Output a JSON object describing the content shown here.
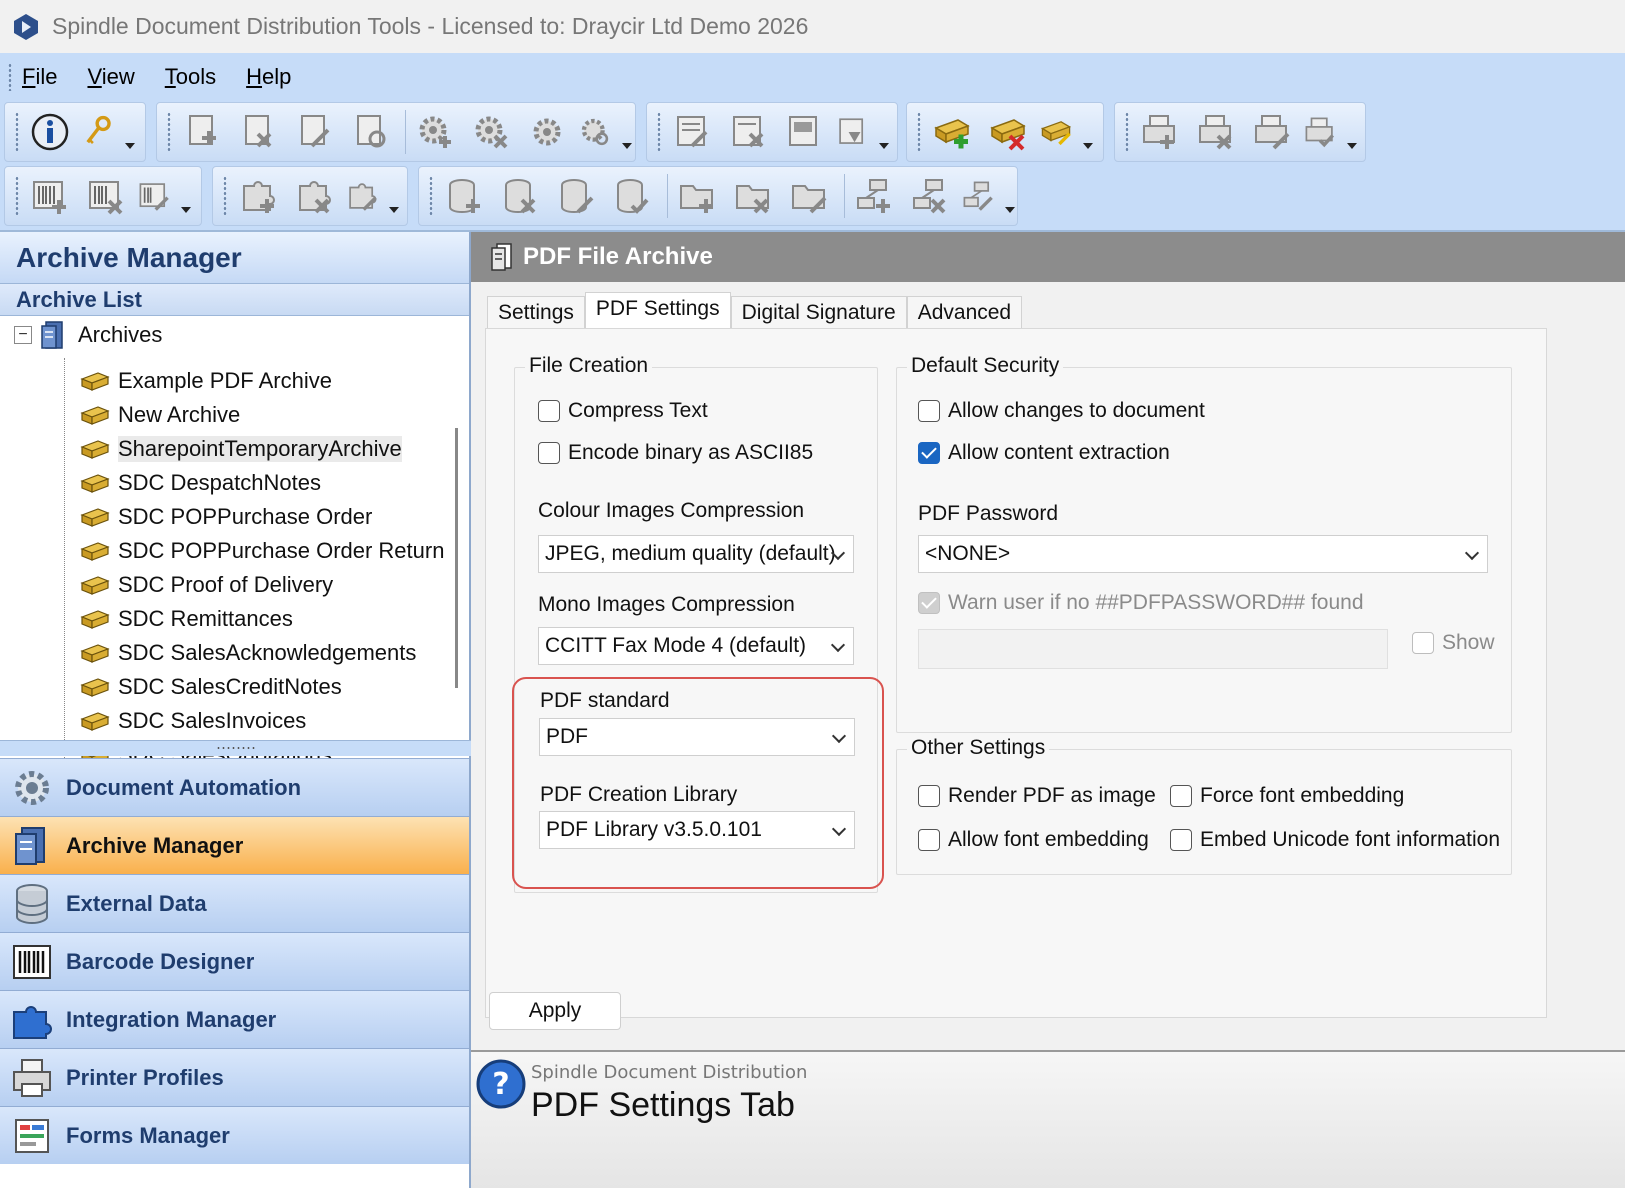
{
  "window": {
    "title": "Spindle Document Distribution Tools - Licensed to: Draycir Ltd Demo 2026"
  },
  "menu": {
    "items": [
      {
        "label": "File",
        "accel": "F",
        "rest": "ile"
      },
      {
        "label": "View",
        "accel": "V",
        "rest": "iew"
      },
      {
        "label": "Tools",
        "accel": "T",
        "rest": "ools"
      },
      {
        "label": "Help",
        "accel": "H",
        "rest": "elp"
      }
    ]
  },
  "toolbar": {
    "icons": [
      "info-icon",
      "key-icon",
      "document-add-icon",
      "document-delete-icon",
      "document-edit-icon",
      "document-refresh-icon",
      "gear-add-icon",
      "gear-delete-icon",
      "gear-edit-icon",
      "gear-refresh-icon",
      "form-edit-icon",
      "form-delete-icon",
      "form-view-icon",
      "form-import-icon",
      "archive-add-icon",
      "archive-delete-icon",
      "archive-edit-icon",
      "printer-add-icon",
      "printer-delete-icon",
      "printer-edit-icon",
      "printer-check-icon",
      "barcode-add-icon",
      "barcode-delete-icon",
      "barcode-edit-icon",
      "puzzle-add-icon",
      "puzzle-delete-icon",
      "puzzle-edit-icon",
      "database-add-icon",
      "database-delete-icon",
      "database-edit-icon",
      "database-check-icon",
      "folder-add-icon",
      "folder-delete-icon",
      "folder-edit-icon",
      "network-add-icon",
      "network-delete-icon",
      "network-edit-icon"
    ]
  },
  "left": {
    "panel_title": "Archive Manager",
    "section_title": "Archive List",
    "tree_root": "Archives",
    "tree_items": [
      "Example PDF Archive",
      "New Archive",
      "SharepointTemporaryArchive",
      "SDC DespatchNotes",
      "SDC POPPurchase Order",
      "SDC POPPurchase Order Return",
      "SDC Proof of Delivery",
      "SDC Remittances",
      "SDC SalesAcknowledgements",
      "SDC SalesCreditNotes",
      "SDC SalesInvoices",
      "SDC SalesQuotations"
    ],
    "selected_item": "SharepointTemporaryArchive",
    "nav": [
      {
        "label": "Document Automation",
        "icon": "gear-cog-icon"
      },
      {
        "label": "Archive Manager",
        "icon": "archive-server-icon"
      },
      {
        "label": "External Data",
        "icon": "database-icon"
      },
      {
        "label": "Barcode Designer",
        "icon": "barcode-icon"
      },
      {
        "label": "Integration Manager",
        "icon": "puzzle-icon"
      },
      {
        "label": "Printer Profiles",
        "icon": "printer-icon"
      },
      {
        "label": "Forms Manager",
        "icon": "form-icon"
      }
    ],
    "active_nav": "Archive Manager"
  },
  "right": {
    "header": "PDF File Archive",
    "tabs": [
      "Settings",
      "PDF Settings",
      "Digital Signature",
      "Advanced"
    ],
    "active_tab": "PDF Settings",
    "file_creation": {
      "legend": "File Creation",
      "compress_text": "Compress Text",
      "encode_binary": "Encode binary as ASCII85",
      "colour_label": "Colour Images Compression",
      "colour_value": "JPEG, medium quality (default)",
      "mono_label": "Mono Images Compression",
      "mono_value": "CCITT Fax Mode 4 (default)",
      "pdf_standard_label": "PDF standard",
      "pdf_standard_value": "PDF",
      "library_label": "PDF Creation Library",
      "library_value": "PDF Library v3.5.0.101"
    },
    "default_security": {
      "legend": "Default Security",
      "allow_changes": "Allow changes to document",
      "allow_extraction": "Allow content extraction",
      "password_label": "PDF Password",
      "password_value": "<NONE>",
      "warn_user": "Warn user if no ##PDFPASSWORD## found",
      "show": "Show"
    },
    "other_settings": {
      "legend": "Other Settings",
      "render_image": "Render PDF as image",
      "force_font": "Force font embedding",
      "allow_font": "Allow font embedding",
      "embed_unicode": "Embed Unicode font information"
    },
    "apply": "Apply",
    "help": {
      "subtitle": "Spindle Document Distribution",
      "title": "PDF Settings Tab"
    }
  },
  "colors": {
    "accent_blue": "#1a66c2",
    "highlight_red": "#d9534f",
    "active_nav": "#f9b04c"
  }
}
